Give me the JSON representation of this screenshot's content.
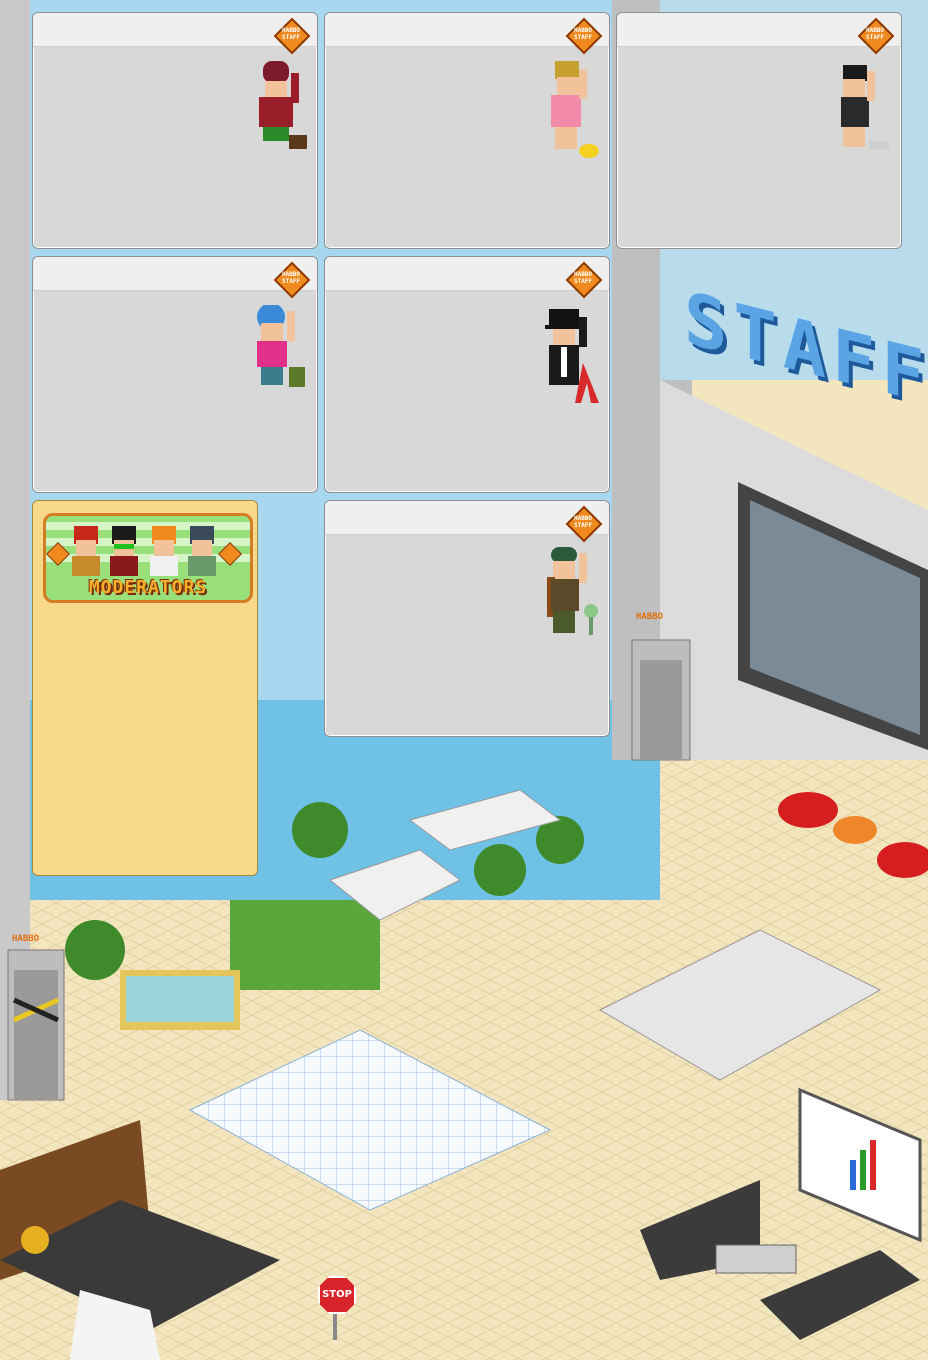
{
  "staff_cards": [
    {
      "badge_line1": "HABBO",
      "badge_line2": "STAFF"
    },
    {
      "badge_line1": "HABBO",
      "badge_line2": "STAFF"
    },
    {
      "badge_line1": "HABBO",
      "badge_line2": "STAFF"
    },
    {
      "badge_line1": "HABBO",
      "badge_line2": "STAFF"
    },
    {
      "badge_line1": "HABBO",
      "badge_line2": "STAFF"
    },
    {
      "badge_line1": "HABBO",
      "badge_line2": "STAFF"
    }
  ],
  "moderators_card": {
    "title": "MODERATORS",
    "badge_line1": "HABBO",
    "badge_line2": "STAFF"
  },
  "room": {
    "wall_sign": "STAFF",
    "elevator_sign_1": "HABBO",
    "elevator_sign_2": "HABBO",
    "stop_sign": "STOP"
  },
  "colors": {
    "card_bg": "#d8d8d8",
    "moderator_bg": "#f8d88a",
    "floor": "#f3e6bf",
    "staff_text": "#5aa4e4"
  }
}
